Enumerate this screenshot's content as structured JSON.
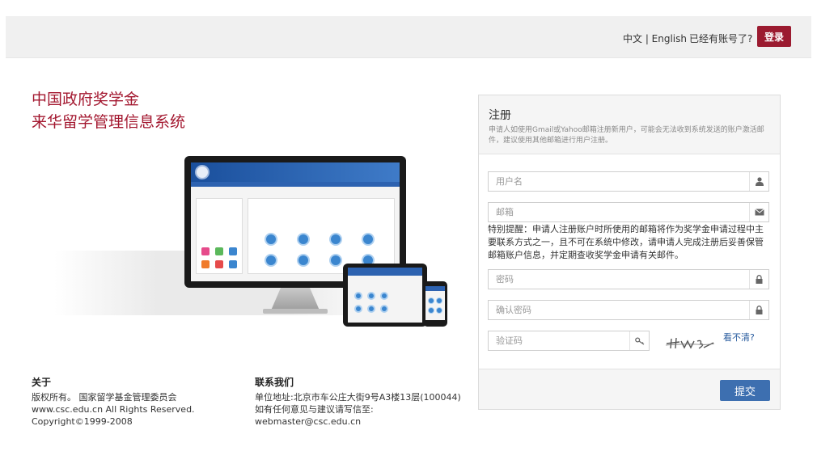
{
  "header": {
    "language_switch": "中文 | English",
    "has_account": "已经有账号了?",
    "login_button": "登录"
  },
  "hero": {
    "title_line1": "中国政府奖学金",
    "title_line2": "来华留学管理信息系统"
  },
  "footer": {
    "about": {
      "heading": "关于",
      "lines": [
        "版权所有。 国家留学基金管理委员会",
        "www.csc.edu.cn All Rights Reserved.",
        "Copyright©1999-2008"
      ]
    },
    "contact": {
      "heading": "联系我们",
      "lines": [
        "单位地址:北京市车公庄大街9号A3楼13层(100044)",
        "如有任何意见与建议请写信至:",
        "webmaster@csc.edu.cn"
      ]
    }
  },
  "register": {
    "title": "注册",
    "note": "申请人如使用Gmail或Yahoo邮箱注册新用户，可能会无法收到系统发送的账户激活邮件，建议使用其他邮箱进行用户注册。",
    "username_placeholder": "用户名",
    "email_placeholder": "邮箱",
    "email_hint": "特别提醒：申请人注册账户时所使用的邮箱将作为奖学金申请过程中主要联系方式之一，且不可在系统中修改，请申请人完成注册后妥善保管邮箱账户信息，并定期查收奖学金申请有关邮件。",
    "password_placeholder": "密码",
    "confirm_password_placeholder": "确认密码",
    "captcha_placeholder": "验证码",
    "captcha_refresh": "看不清?",
    "submit_button": "提交"
  },
  "icons": {
    "username": "user-icon",
    "email": "envelope-icon",
    "password": "lock-icon",
    "confirm_password": "lock-icon",
    "captcha": "key-icon"
  },
  "colors": {
    "brand_red": "#9b1b30",
    "title_red": "#a3172f",
    "submit_blue": "#3d6fb0",
    "link_blue": "#2a5d9f"
  }
}
